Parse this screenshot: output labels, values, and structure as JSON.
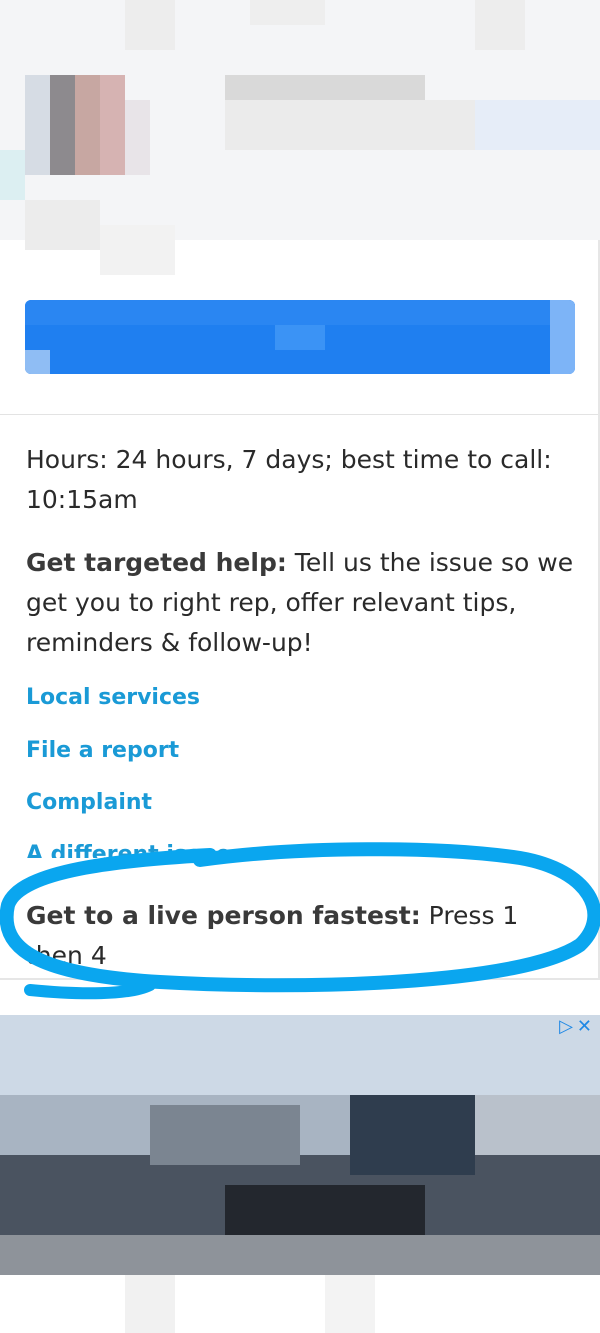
{
  "hours": {
    "text_line1": "Hours: 24 hours, 7 days; best time to call:",
    "text_line2": "10:15am"
  },
  "targeted_help": {
    "label": "Get targeted help:",
    "text_line1": " Tell us the issue so we",
    "text_line2": "get you to right rep, offer relevant tips,",
    "text_line3": "reminders & follow-up!"
  },
  "links": {
    "local_services": "Local services",
    "file_report": "File a report",
    "complaint": "Complaint",
    "different_issue": "A different issue"
  },
  "live_person": {
    "label": "Get to a live person fastest:",
    "value": " Press 1 then 4"
  },
  "ad": {
    "adchoices_icon": "adchoices-triangle-icon",
    "close_icon": "close-icon"
  },
  "colors": {
    "link": "#1a9ad6",
    "primary_button": "#1f7ff0",
    "highlight_stroke": "#0aa6ef"
  }
}
